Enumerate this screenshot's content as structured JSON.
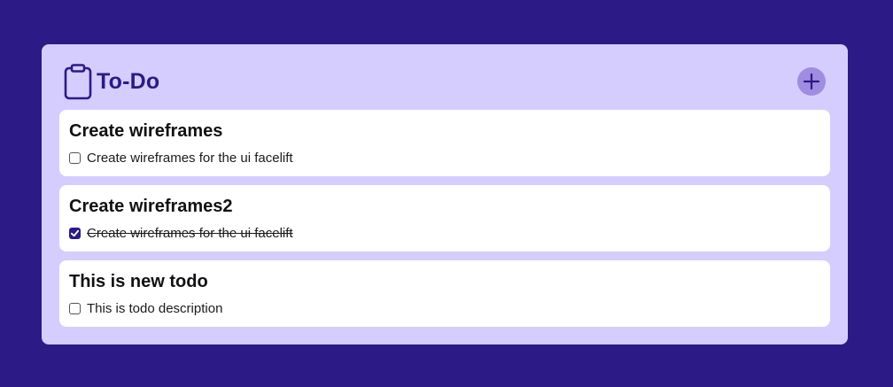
{
  "app": {
    "title": "To-Do",
    "title_icon": "clipboard-icon",
    "add_icon": "plus-icon"
  },
  "colors": {
    "background": "#2c1a86",
    "panel": "#d5cdfd",
    "accent": "#2c1a86",
    "add_button": "#9e8de0",
    "card": "#ffffff"
  },
  "todos": [
    {
      "title": "Create wireframes",
      "description": "Create wireframes for the ui facelift",
      "done": false
    },
    {
      "title": "Create wireframes2",
      "description": "Create wireframes for the ui facelift",
      "done": true
    },
    {
      "title": "This is new todo",
      "description": "This is todo description",
      "done": false
    }
  ]
}
